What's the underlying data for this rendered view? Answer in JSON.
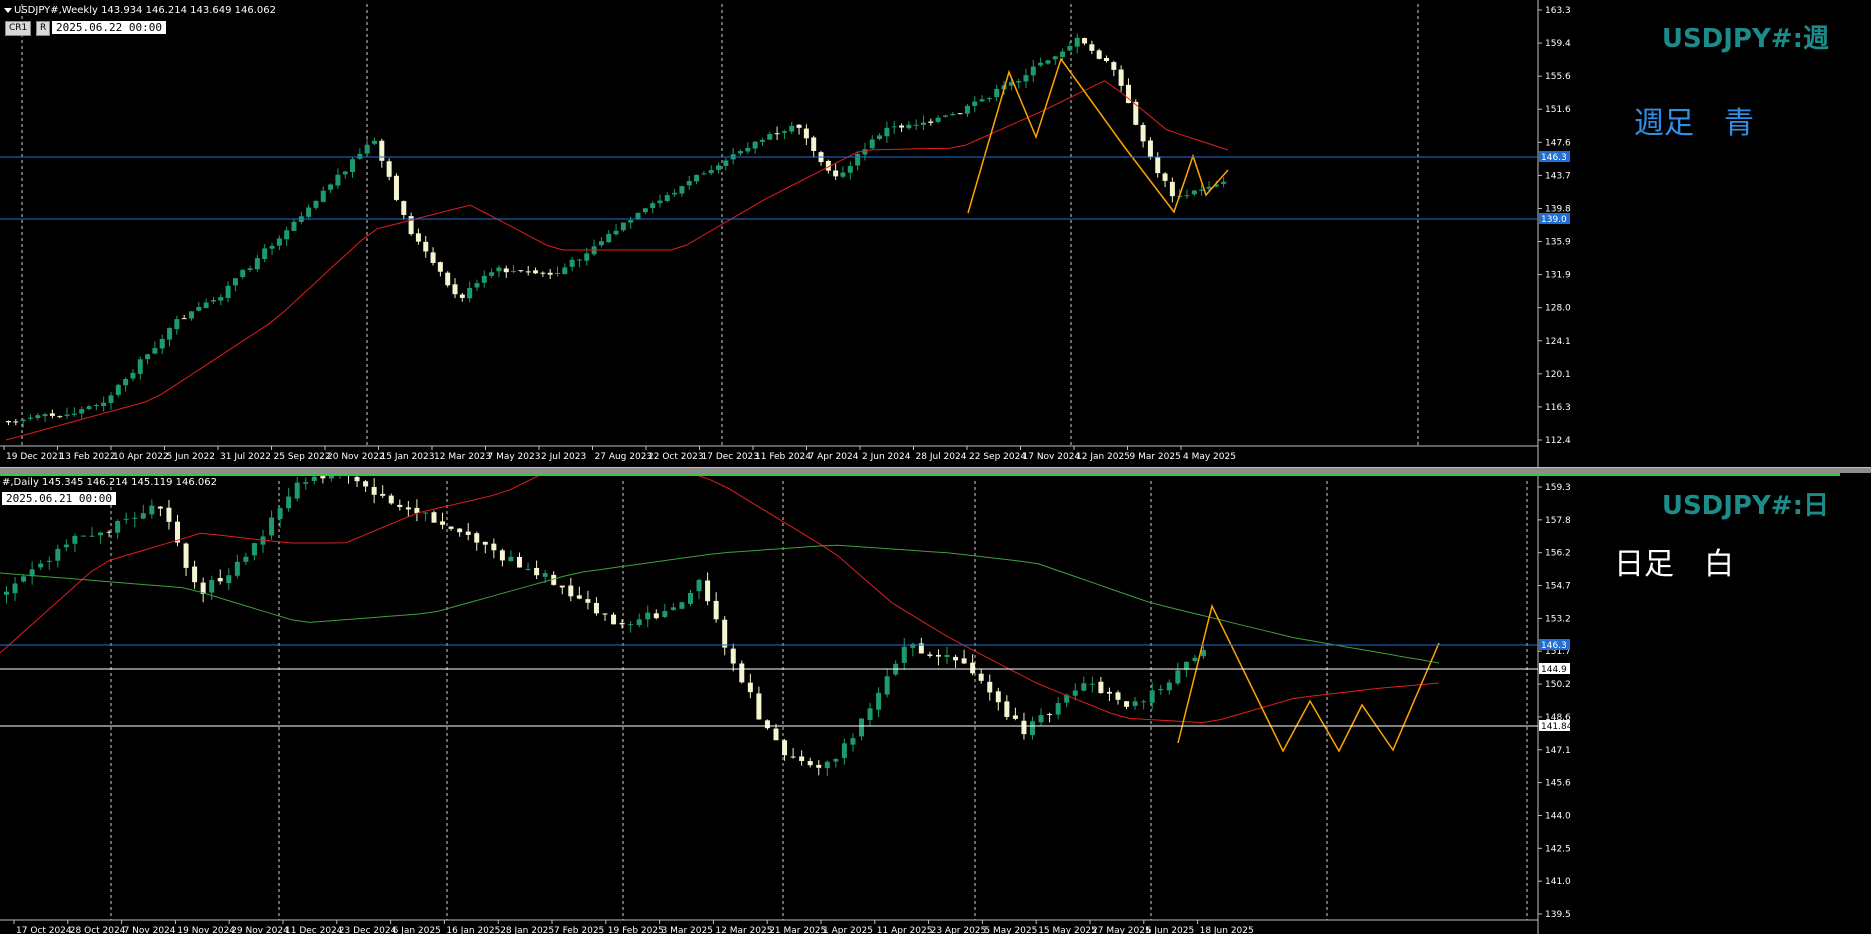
{
  "weekly": {
    "info": "USDJPY#,Weekly  143.934 146.214 143.649 146.062",
    "buttons": [
      "CR1",
      "R"
    ],
    "date_box": "2025.06.22 00:00",
    "title": "USDJPY#:週",
    "note": "週足　青",
    "note_color": "#2f8fe6",
    "hlines": [
      {
        "label": "146.3",
        "color": "#1f6fd6"
      },
      {
        "label": "139.0",
        "color": "#1f6fd6"
      }
    ],
    "price_ticks": [
      "163.3",
      "159.4",
      "155.6",
      "151.6",
      "147.6",
      "143.7",
      "139.8",
      "135.9",
      "131.9",
      "128.0",
      "124.1",
      "120.1",
      "116.3",
      "112.4"
    ],
    "date_ticks": [
      "19 Dec 2021",
      "13 Feb 2022",
      "10 Apr 2022",
      "5 Jun 2022",
      "31 Jul 2022",
      "25 Sep 2022",
      "20 Nov 2022",
      "15 Jan 2023",
      "12 Mar 2023",
      "7 May 2023",
      "2 Jul 2023",
      "27 Aug 2023",
      "22 Oct 2023",
      "17 Dec 2023",
      "11 Feb 2024",
      "7 Apr 2024",
      "2 Jun 2024",
      "28 Jul 2024",
      "22 Sep 2024",
      "17 Nov 2024",
      "12 Jan 2025",
      "9 Mar 2025",
      "4 May 2025"
    ]
  },
  "daily": {
    "info": "#,Daily  145.345 146.214 145.119 146.062",
    "date_box": "2025.06.21 00:00",
    "title": "USDJPY#:日",
    "note": "日足　白",
    "note_color": "#ffffff",
    "hlines": [
      {
        "label": "146.3",
        "color": "#1f6fd6"
      },
      {
        "label": "144.9",
        "color": "#ffffff"
      },
      {
        "label": "141.84",
        "color": "#ffffff"
      }
    ],
    "price_ticks": [
      "159.3",
      "157.8",
      "156.2",
      "154.7",
      "153.2",
      "151.7",
      "150.2",
      "148.6",
      "147.1",
      "145.6",
      "144.0",
      "142.5",
      "141.0",
      "139.5"
    ],
    "date_ticks": [
      "17 Oct 2024",
      "28 Oct 2024",
      "7 Nov 2024",
      "19 Nov 2024",
      "29 Nov 2024",
      "11 Dec 2024",
      "23 Dec 2024",
      "6 Jan 2025",
      "16 Jan 2025",
      "28 Jan 2025",
      "7 Feb 2025",
      "19 Feb 2025",
      "3 Mar 2025",
      "12 Mar 2025",
      "21 Mar 2025",
      "1 Apr 2025",
      "11 Apr 2025",
      "23 Apr 2025",
      "5 May 2025",
      "15 May 2025",
      "27 May 2025",
      "6 Jun 2025",
      "18 Jun 2025"
    ]
  },
  "colors": {
    "bull": "#1e9b6a",
    "bear": "#f5f5d0",
    "ma_red": "#e01e1e",
    "ma_green": "#3f9f3f",
    "zigzag": "#ffa500",
    "axis_title": "#1e8b8b"
  }
}
